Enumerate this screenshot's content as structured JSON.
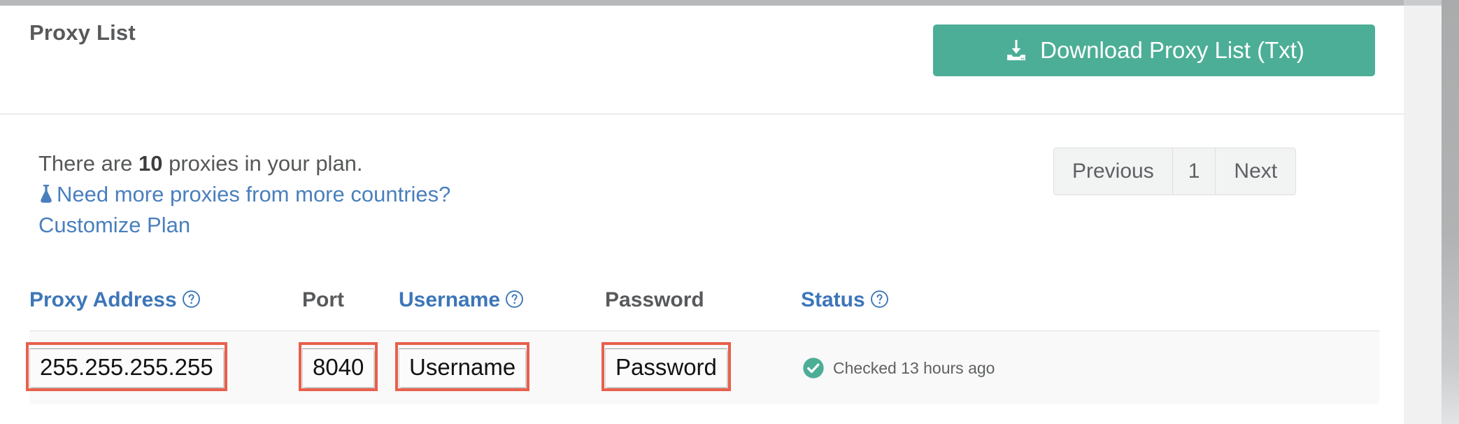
{
  "header": {
    "title": "Proxy List",
    "download_button": {
      "label": "Download Proxy List (Txt)",
      "icon": "download-tray-icon",
      "color": "#4cae96"
    }
  },
  "plan_info": {
    "prefix": "There are ",
    "count": "10",
    "suffix": " proxies in your plan.",
    "link_icon": "flask-icon",
    "link_text": "Need more proxies from more countries? Customize Plan",
    "link_color": "#4a7fbd"
  },
  "pagination": {
    "previous_label": "Previous",
    "current_page": "1",
    "next_label": "Next"
  },
  "table": {
    "columns": [
      {
        "label": "Proxy Address",
        "has_help": true,
        "color": "#3d76b8",
        "help_icon": "question-circle-icon"
      },
      {
        "label": "Port",
        "has_help": false,
        "color": "#58595b",
        "help_icon": ""
      },
      {
        "label": "Username",
        "has_help": true,
        "color": "#3d76b8",
        "help_icon": "question-circle-icon"
      },
      {
        "label": "Password",
        "has_help": false,
        "color": "#58595b",
        "help_icon": ""
      },
      {
        "label": "Status",
        "has_help": true,
        "color": "#3d76b8",
        "help_icon": "question-circle-icon"
      }
    ],
    "rows": [
      {
        "proxy_address": "255.255.255.255",
        "port": "8040",
        "username": "Username",
        "password": "Password",
        "status_icon": "check-circle-icon",
        "status_text": "Checked 13 hours ago",
        "status_icon_color": "#4cae96"
      }
    ]
  },
  "annotations": {
    "color": "#e95f4c",
    "boxes": [
      "proxy-address-cell",
      "port-cell",
      "username-cell",
      "password-cell"
    ]
  }
}
